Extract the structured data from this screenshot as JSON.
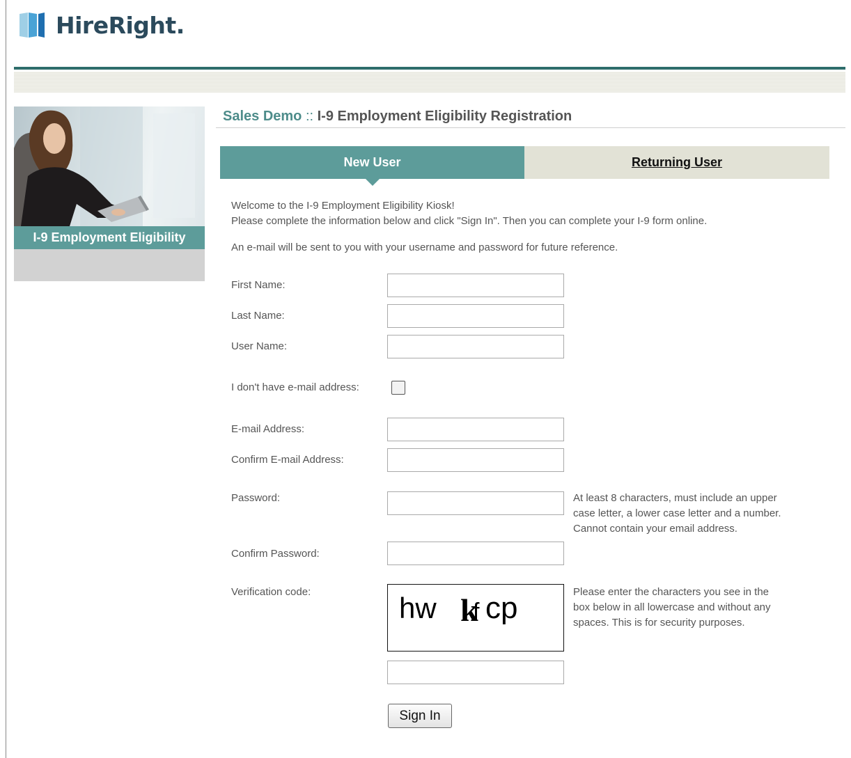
{
  "header": {
    "logo_text": "HireRight."
  },
  "sidebar": {
    "label": "I-9 Employment Eligibility"
  },
  "page": {
    "title_demo": "Sales Demo",
    "title_sep": " :: ",
    "title_rest": "I-9 Employment Eligibility Registration"
  },
  "tabs": {
    "new_user": "New User",
    "returning_user": "Returning User"
  },
  "intro": {
    "line1": "Welcome to the I-9 Employment Eligibility Kiosk!",
    "line2": "Please complete the information below and click \"Sign In\". Then you can complete your I-9 form online.",
    "line3": "An e-mail will be sent to you with your username and password for future reference."
  },
  "form": {
    "first_name_label": "First Name:",
    "last_name_label": "Last Name:",
    "user_name_label": "User Name:",
    "no_email_label": "I don't have e-mail address:",
    "email_label": "E-mail Address:",
    "confirm_email_label": "Confirm E-mail Address:",
    "password_label": "Password:",
    "password_hint_1": "At least 8 characters, must include an upper",
    "password_hint_2": "case letter, a lower case letter and a number.",
    "password_hint_3": "Cannot contain your email address.",
    "confirm_password_label": "Confirm Password:",
    "verification_label": "Verification code:",
    "captcha_text": "hw kfcp",
    "captcha_hint_1": "Please enter the characters you see in the",
    "captcha_hint_2": "box below in all lowercase and without any",
    "captcha_hint_3": "spaces. This is for security purposes.",
    "sign_in_label": "Sign In",
    "no_email_checked": false
  },
  "colors": {
    "teal": "#5d9c9a",
    "teal_dark": "#2e6d6b",
    "tab_inactive": "#e2e2d6",
    "brand_navy": "#2b4a5c"
  }
}
